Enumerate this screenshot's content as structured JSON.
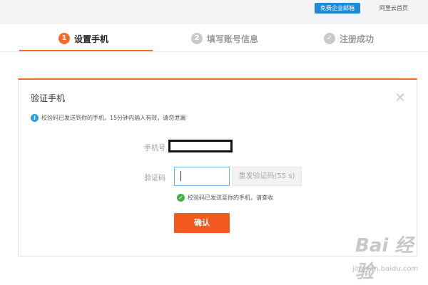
{
  "topbar": {
    "promo_label": "免费企业邮箱",
    "home_label": "阿里云首页"
  },
  "steps": [
    {
      "number": "1",
      "label": "设置手机",
      "state": "active"
    },
    {
      "number": "2",
      "label": "填写账号信息",
      "state": "inactive"
    },
    {
      "number": "✓",
      "label": "注册成功",
      "state": "inactive"
    }
  ],
  "dialog": {
    "title": "验证手机",
    "info": "校验码已发送到你的手机，15分钟内输入有效，请勿泄漏",
    "phone_label": "手机号",
    "code_label": "验证码",
    "code_value": "",
    "resend_label": "重发验证码(55 s)",
    "success_message": "校验码已发送至你的手机，请查收",
    "confirm_label": "确认"
  },
  "watermark": {
    "logo_text": "Bai 经验",
    "url": "jingyan.baidu.com"
  },
  "colors": {
    "accent": "#f26b2a",
    "info_blue": "#2d9ce0",
    "success_green": "#43b049"
  }
}
